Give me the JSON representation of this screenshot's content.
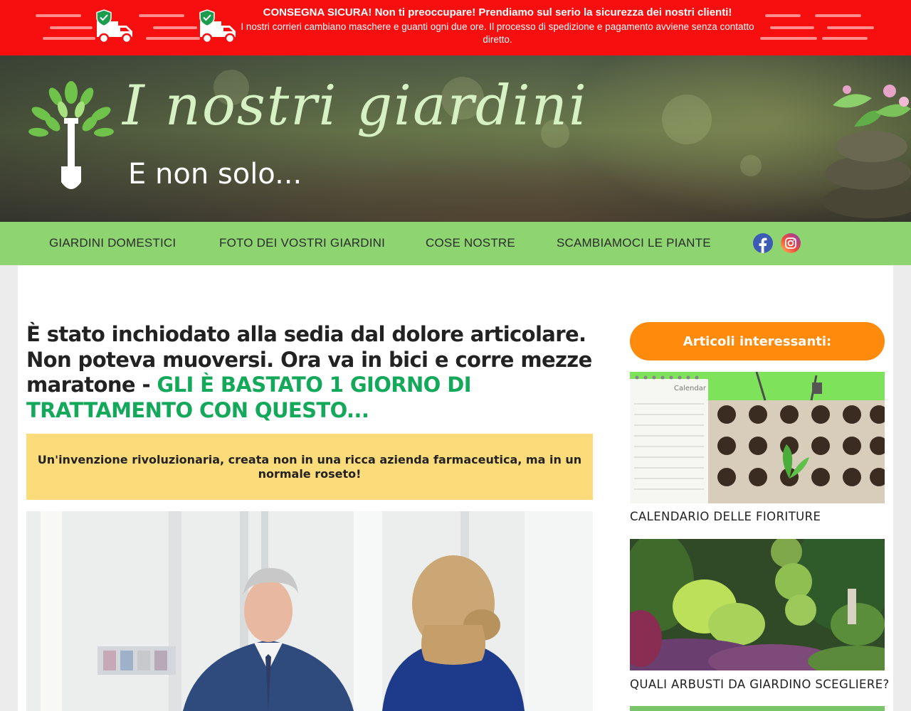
{
  "banner": {
    "title": "CONSEGNA SICURA! Non ti preoccupare! Prendiamo sul serio la sicurezza dei nostri clienti!",
    "subtitle": "I nostri corrieri cambiano maschere e guanti ogni due ore. Il processo di spedizione e pagamento avviene senza contatto diretto.",
    "background_color": "#f70f0f",
    "icons": [
      "delivery-truck-shield-icon",
      "delivery-truck-shield-icon"
    ]
  },
  "header": {
    "logo_title": "I nostri giardini",
    "logo_subtitle": "E non solo...",
    "logo_icon": "tree-shovel-icon"
  },
  "nav": {
    "background_color": "#8ed572",
    "items": [
      {
        "label": "GIARDINI DOMESTICI"
      },
      {
        "label": "FOTO DEI VOSTRI GIARDINI"
      },
      {
        "label": "COSE NOSTRE"
      },
      {
        "label": "SCAMBIAMOCI LE PIANTE"
      }
    ],
    "social": [
      "facebook-icon",
      "instagram-icon"
    ]
  },
  "article": {
    "headline_main": "È stato inchiodato alla sedia dal dolore articolare. Non poteva muoversi. Ora va in bici e corre mezze maratone - ",
    "headline_accent": "GLI È BASTATO 1 GIORNO DI TRATTAMENTO CON QUESTO...",
    "accent_color": "#13a85a",
    "callout": "Un'invenzione rivoluzionaria, creata non in una ricca azienda farmaceutica, ma in un normale roseto!",
    "callout_color": "#fcdb7b"
  },
  "sidebar": {
    "title": "Articoli interessanti:",
    "title_color": "#ff8a0c",
    "cards": [
      {
        "label": "CALENDARIO DELLE FIORITURE",
        "image_text": "Calendar"
      },
      {
        "label": "QUALI ARBUSTI DA GIARDINO SCEGLIERE?"
      }
    ]
  }
}
